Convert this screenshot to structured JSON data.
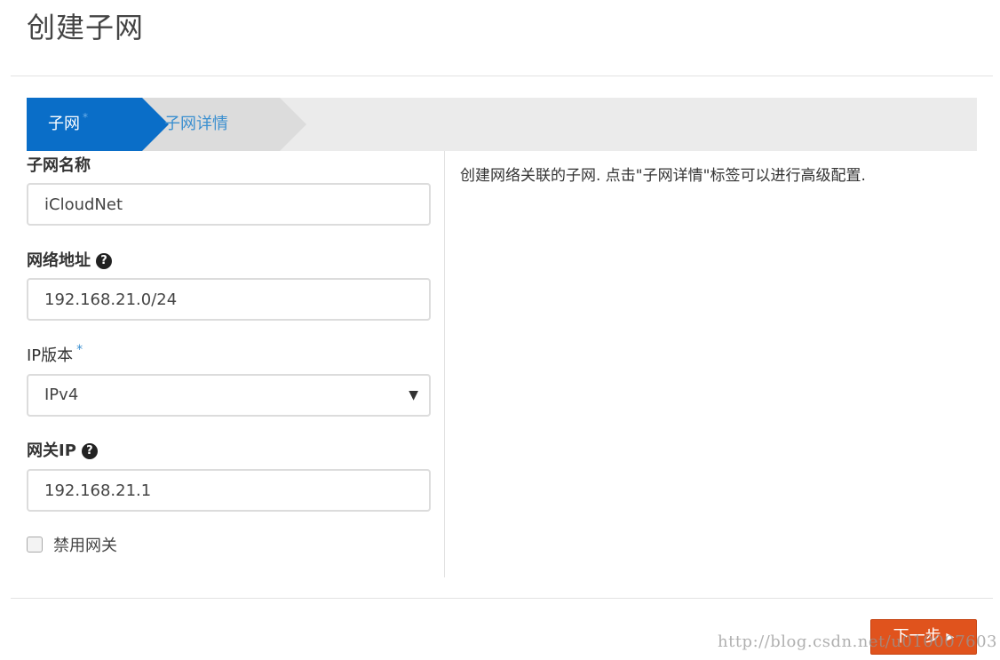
{
  "page": {
    "title": "创建子网"
  },
  "wizard": {
    "steps": [
      {
        "label": "子网",
        "required_mark": "*",
        "active": true
      },
      {
        "label": "子网详情",
        "active": false
      }
    ]
  },
  "form": {
    "subnet_name": {
      "label": "子网名称",
      "value": "iCloudNet"
    },
    "network_address": {
      "label": "网络地址",
      "value": "192.168.21.0/24",
      "help_icon": "question-circle-icon"
    },
    "ip_version": {
      "label": "IP版本",
      "required_mark": "*",
      "selected": "IPv4"
    },
    "gateway_ip": {
      "label": "网关IP",
      "value": "192.168.21.1",
      "help_icon": "question-circle-icon"
    },
    "disable_gateway": {
      "label": "禁用网关",
      "checked": false
    }
  },
  "help": {
    "text": "创建网络关联的子网. 点击\"子网详情\"标签可以进行高级配置."
  },
  "footer": {
    "next_label": "下一步 ▸"
  },
  "watermark": "http://blog.csdn.net/u010007603",
  "colors": {
    "accent": "#0a6ec8",
    "primary_button": "#e0531d",
    "link": "#3a8fd0"
  }
}
